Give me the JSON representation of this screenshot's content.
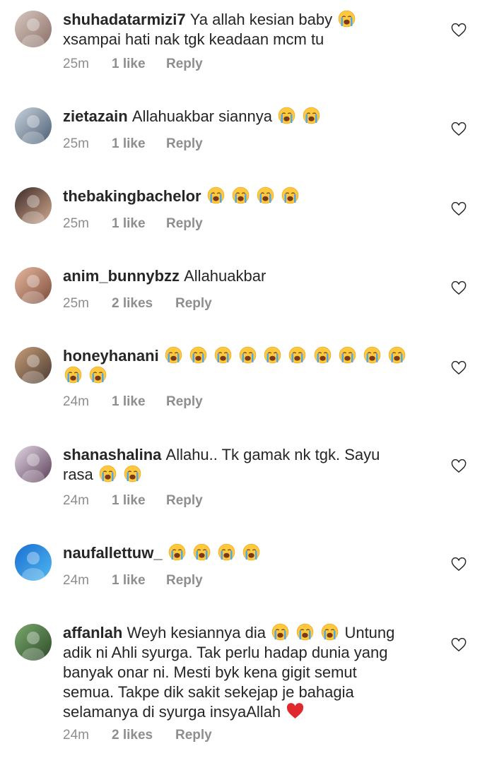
{
  "icons": {
    "like": "heart-outline-icon",
    "crying": "loudly-crying-face-emoji",
    "love": "red-heart-emoji"
  },
  "colors": {
    "meta": "#8e8e8e",
    "text": "#262626",
    "emoji_face": "#FFC83D",
    "tear": "#4FA8E8",
    "heart": "#E0282F"
  },
  "comments": [
    {
      "username": "shuhadatarmizi7",
      "lines": [
        "Ya allah kesian baby [crying]",
        "xsampai hati nak tgk keadaan mcm tu"
      ],
      "time": "25m",
      "likes": "1 like",
      "reply": "Reply"
    },
    {
      "username": "zietazain",
      "lines": [
        "Allahuakbar siannya [crying] [crying]"
      ],
      "time": "25m",
      "likes": "1 like",
      "reply": "Reply"
    },
    {
      "username": "thebakingbachelor",
      "lines": [
        "[crying] [crying] [crying] [crying]"
      ],
      "time": "25m",
      "likes": "1 like",
      "reply": "Reply"
    },
    {
      "username": "anim_bunnybzz",
      "lines": [
        "Allahuakbar"
      ],
      "time": "25m",
      "likes": "2 likes",
      "reply": "Reply"
    },
    {
      "username": "honeyhanani",
      "lines": [
        "[crying] [crying] [crying] [crying] [crying] [crying] [crying] [crying] [crying] [crying]",
        "[crying] [crying]"
      ],
      "time": "24m",
      "likes": "1 like",
      "reply": "Reply"
    },
    {
      "username": "shanashalina",
      "lines": [
        "Allahu.. Tk gamak nk tgk. Sayu",
        "rasa [crying] [crying]"
      ],
      "time": "24m",
      "likes": "1 like",
      "reply": "Reply"
    },
    {
      "username": "naufallettuw_",
      "lines": [
        "[crying] [crying] [crying] [crying]"
      ],
      "time": "24m",
      "likes": "1 like",
      "reply": "Reply"
    },
    {
      "username": "affanlah",
      "lines": [
        "Weyh kesiannya dia [crying] [crying] [crying] Untung",
        "adik ni Ahli syurga. Tak perlu hadap dunia yang",
        "banyak onar ni. Mesti byk kena gigit semut",
        "semua. Takpe dik sakit sekejap je bahagia",
        "selamanya di syurga insyaAllah [heart]"
      ],
      "time": "24m",
      "likes": "2 likes",
      "reply": "Reply"
    }
  ]
}
